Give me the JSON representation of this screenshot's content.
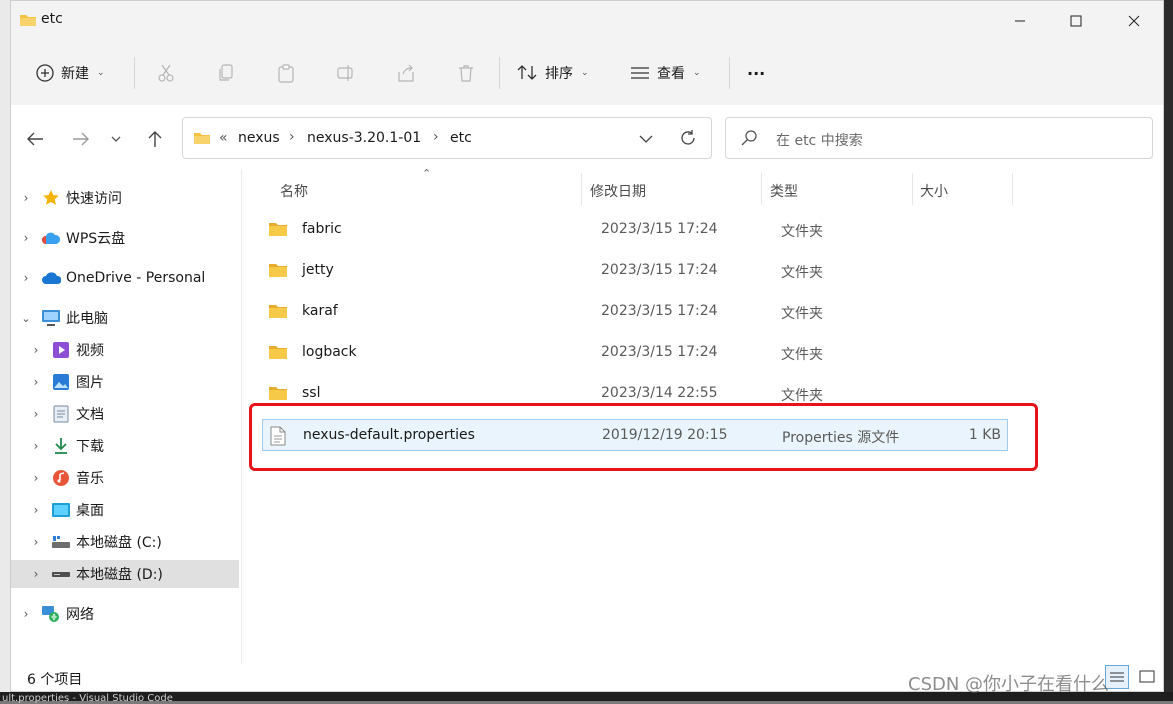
{
  "window": {
    "title": "etc"
  },
  "toolbar": {
    "new_label": "新建",
    "sort_label": "排序",
    "view_label": "查看",
    "more_label": "···"
  },
  "address": {
    "overflow": "«",
    "parts": [
      "nexus",
      "nexus-3.20.1-01",
      "etc"
    ]
  },
  "search": {
    "placeholder": "在 etc 中搜索"
  },
  "sidebar": {
    "items": [
      {
        "label": "快速访问",
        "icon": "star-icon"
      },
      {
        "label": "WPS云盘",
        "icon": "cloud-icon"
      },
      {
        "label": "OneDrive - Personal",
        "icon": "onedrive-icon"
      },
      {
        "label": "此电脑",
        "icon": "computer-icon"
      },
      {
        "label": "视频",
        "icon": "video-icon"
      },
      {
        "label": "图片",
        "icon": "picture-icon"
      },
      {
        "label": "文档",
        "icon": "document-icon"
      },
      {
        "label": "下载",
        "icon": "download-icon"
      },
      {
        "label": "音乐",
        "icon": "music-icon"
      },
      {
        "label": "桌面",
        "icon": "desktop-icon"
      },
      {
        "label": "本地磁盘 (C:)",
        "icon": "drive-icon"
      },
      {
        "label": "本地磁盘 (D:)",
        "icon": "drive-icon"
      },
      {
        "label": "网络",
        "icon": "network-icon"
      }
    ]
  },
  "columns": {
    "name": "名称",
    "date": "修改日期",
    "type": "类型",
    "size": "大小"
  },
  "files": [
    {
      "name": "fabric",
      "date": "2023/3/15 17:24",
      "type": "文件夹",
      "size": ""
    },
    {
      "name": "jetty",
      "date": "2023/3/15 17:24",
      "type": "文件夹",
      "size": ""
    },
    {
      "name": "karaf",
      "date": "2023/3/15 17:24",
      "type": "文件夹",
      "size": ""
    },
    {
      "name": "logback",
      "date": "2023/3/15 17:24",
      "type": "文件夹",
      "size": ""
    },
    {
      "name": "ssl",
      "date": "2023/3/14 22:55",
      "type": "文件夹",
      "size": ""
    },
    {
      "name": "nexus-default.properties",
      "date": "2019/12/19 20:15",
      "type": "Properties 源文件",
      "size": "1 KB"
    }
  ],
  "status": {
    "item_count": "6 个项目"
  },
  "watermark": "CSDN @你小子在看什么",
  "background_window": {
    "text": "ult.properties - Visual Studio Code"
  },
  "colors": {
    "highlight": "#e8121a",
    "folder": "#f5c242",
    "accent": "#0067c0"
  }
}
